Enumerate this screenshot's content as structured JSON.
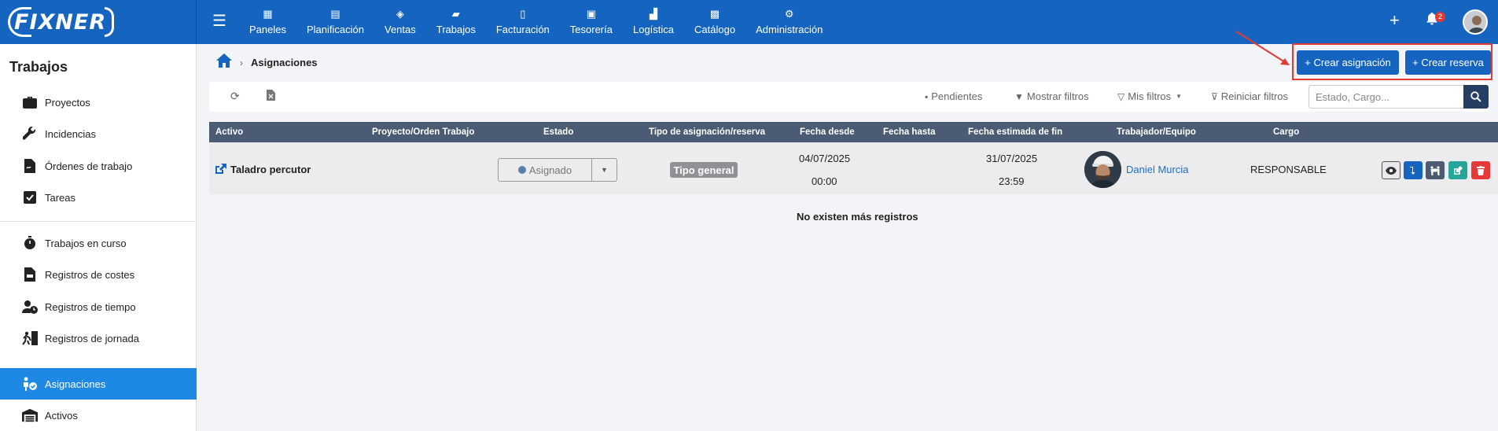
{
  "brand": "FIXNER",
  "topnav": {
    "items": [
      {
        "label": "Paneles",
        "icon": "dashboard-icon"
      },
      {
        "label": "Planificación",
        "icon": "calendar-icon"
      },
      {
        "label": "Ventas",
        "icon": "handshake-icon"
      },
      {
        "label": "Trabajos",
        "icon": "folder-icon"
      },
      {
        "label": "Facturación",
        "icon": "invoice-icon"
      },
      {
        "label": "Tesorería",
        "icon": "cash-register-icon"
      },
      {
        "label": "Logística",
        "icon": "dolly-icon"
      },
      {
        "label": "Catálogo",
        "icon": "boxes-icon"
      },
      {
        "label": "Administración",
        "icon": "gear-icon"
      }
    ],
    "notifications_count": "2"
  },
  "sidebar": {
    "title": "Trabajos",
    "items": [
      {
        "label": "Proyectos",
        "icon": "briefcase-icon"
      },
      {
        "label": "Incidencias",
        "icon": "wrench-icon"
      },
      {
        "label": "Órdenes de trabajo",
        "icon": "file-signature-icon"
      },
      {
        "label": "Tareas",
        "icon": "check-square-icon"
      },
      {
        "label": "Trabajos en curso",
        "icon": "stopwatch-icon"
      },
      {
        "label": "Registros de costes",
        "icon": "file-invoice-icon"
      },
      {
        "label": "Registros de tiempo",
        "icon": "user-clock-icon"
      },
      {
        "label": "Registros de jornada",
        "icon": "running-person-icon"
      },
      {
        "label": "Asignaciones",
        "icon": "user-check-icon"
      },
      {
        "label": "Activos",
        "icon": "warehouse-icon"
      }
    ],
    "active": "Asignaciones"
  },
  "breadcrumb": {
    "current": "Asignaciones"
  },
  "actions": {
    "create_assignment": "+ Crear asignación",
    "create_reservation": "+ Crear reserva"
  },
  "toolbar": {
    "pendientes": "Pendientes",
    "mostrar_filtros": "Mostrar filtros",
    "mis_filtros": "Mis filtros",
    "reiniciar_filtros": "Reiniciar filtros",
    "search_placeholder": "Estado, Cargo..."
  },
  "table": {
    "headers": [
      "Activo",
      "Proyecto/Orden Trabajo",
      "Estado",
      "Tipo de asignación/reserva",
      "Fecha desde",
      "Fecha hasta",
      "Fecha estimada de fin",
      "Trabajador/Equipo",
      "Cargo"
    ],
    "rows": [
      {
        "activo": "Taladro percutor",
        "proyecto": "",
        "estado": "Asignado",
        "tipo": "Tipo general",
        "fecha_desde": "04/07/2025",
        "hora_desde": "00:00",
        "fecha_hasta": "",
        "fecha_fin": "31/07/2025",
        "hora_fin": "23:59",
        "trabajador": "Daniel Murcia",
        "cargo": "RESPONSABLE"
      }
    ],
    "empty_message": "No existen más registros"
  },
  "colors": {
    "primary": "#1565c0",
    "sidebar_active": "#1e88e5",
    "table_header": "#4a5b73",
    "highlight": "#e53935"
  }
}
